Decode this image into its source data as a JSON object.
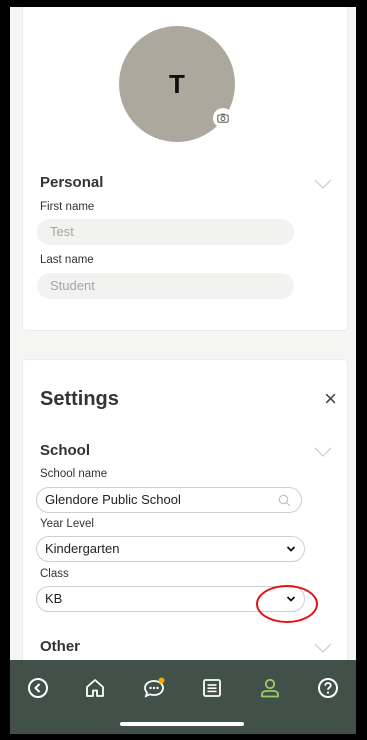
{
  "profile": {
    "avatar_initial": "T"
  },
  "personal": {
    "title": "Personal",
    "first_name_label": "First name",
    "first_name_value": "Test",
    "last_name_label": "Last name",
    "last_name_value": "Student"
  },
  "settings": {
    "title": "Settings",
    "close_glyph": "×",
    "school_section_title": "School",
    "school_name_label": "School name",
    "school_name_value": "Glendore Public School",
    "year_level_label": "Year Level",
    "year_level_value": "Kindergarten",
    "class_label": "Class",
    "class_value": "KB",
    "other_section_title": "Other"
  },
  "navbar": {
    "items": [
      {
        "icon": "back-circle-icon"
      },
      {
        "icon": "home-icon"
      },
      {
        "icon": "chat-icon"
      },
      {
        "icon": "list-icon"
      },
      {
        "icon": "profile-icon"
      },
      {
        "icon": "help-icon"
      }
    ],
    "active_color": "#9ccc65",
    "badge_color": "#f2a900"
  }
}
